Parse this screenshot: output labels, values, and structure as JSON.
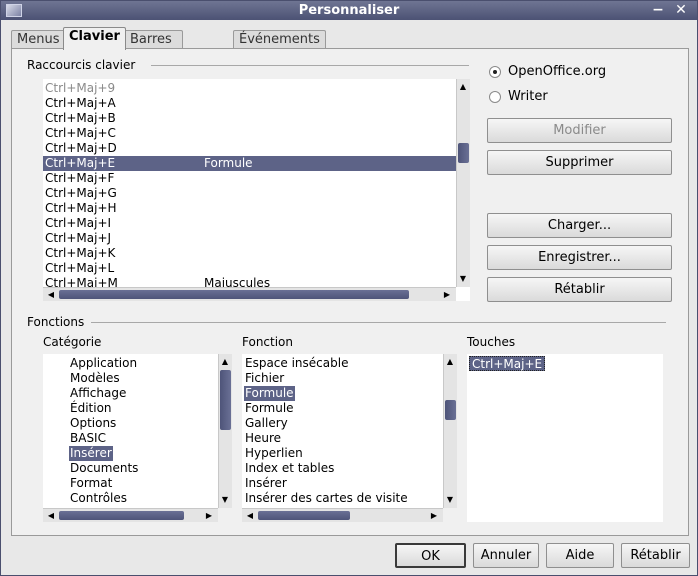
{
  "window": {
    "title": "Personnaliser",
    "minimize_glyph": "−",
    "close_glyph": "✕"
  },
  "tabs": [
    {
      "label": "Menus",
      "active": false
    },
    {
      "label": "Clavier",
      "active": true
    },
    {
      "label": "Barres d'outils",
      "active": false
    },
    {
      "label": "Événements",
      "active": false
    }
  ],
  "shortcuts": {
    "group_label": "Raccourcis clavier",
    "rows": [
      {
        "key": "Ctrl+Maj+9",
        "function": "",
        "selected": false,
        "dimmed": true
      },
      {
        "key": "Ctrl+Maj+A",
        "function": "",
        "selected": false,
        "dimmed": false
      },
      {
        "key": "Ctrl+Maj+B",
        "function": "",
        "selected": false,
        "dimmed": false
      },
      {
        "key": "Ctrl+Maj+C",
        "function": "",
        "selected": false,
        "dimmed": false
      },
      {
        "key": "Ctrl+Maj+D",
        "function": "",
        "selected": false,
        "dimmed": false
      },
      {
        "key": "Ctrl+Maj+E",
        "function": "Formule",
        "selected": true,
        "dimmed": false
      },
      {
        "key": "Ctrl+Maj+F",
        "function": "",
        "selected": false,
        "dimmed": false
      },
      {
        "key": "Ctrl+Maj+G",
        "function": "",
        "selected": false,
        "dimmed": false
      },
      {
        "key": "Ctrl+Maj+H",
        "function": "",
        "selected": false,
        "dimmed": false
      },
      {
        "key": "Ctrl+Maj+I",
        "function": "",
        "selected": false,
        "dimmed": false
      },
      {
        "key": "Ctrl+Maj+J",
        "function": "",
        "selected": false,
        "dimmed": false
      },
      {
        "key": "Ctrl+Maj+K",
        "function": "",
        "selected": false,
        "dimmed": false
      },
      {
        "key": "Ctrl+Maj+L",
        "function": "",
        "selected": false,
        "dimmed": false
      },
      {
        "key": "Ctrl+Maj+M",
        "function": "Majuscules",
        "selected": false,
        "dimmed": false
      }
    ]
  },
  "scope": {
    "options": [
      {
        "label": "OpenOffice.org",
        "checked": true
      },
      {
        "label": "Writer",
        "checked": false
      }
    ]
  },
  "buttons": {
    "modifier": "Modifier",
    "supprimer": "Supprimer",
    "charger": "Charger...",
    "enregistrer": "Enregistrer...",
    "retablir": "Rétablir"
  },
  "functions": {
    "group_label": "Fonctions",
    "category_label": "Catégorie",
    "function_label": "Fonction",
    "keys_label": "Touches",
    "categories": [
      {
        "label": "Application",
        "selected": false
      },
      {
        "label": "Modèles",
        "selected": false
      },
      {
        "label": "Affichage",
        "selected": false
      },
      {
        "label": "Édition",
        "selected": false
      },
      {
        "label": "Options",
        "selected": false
      },
      {
        "label": "BASIC",
        "selected": false
      },
      {
        "label": "Insérer",
        "selected": true
      },
      {
        "label": "Documents",
        "selected": false
      },
      {
        "label": "Format",
        "selected": false
      },
      {
        "label": "Contrôles",
        "selected": false
      }
    ],
    "function_items": [
      {
        "label": "Espace insécable",
        "selected": false
      },
      {
        "label": "Fichier",
        "selected": false
      },
      {
        "label": "Formule",
        "selected": true
      },
      {
        "label": "Formule",
        "selected": false
      },
      {
        "label": "Gallery",
        "selected": false
      },
      {
        "label": "Heure",
        "selected": false
      },
      {
        "label": "Hyperlien",
        "selected": false
      },
      {
        "label": "Index et tables",
        "selected": false
      },
      {
        "label": "Insérer",
        "selected": false
      },
      {
        "label": "Insérer des cartes de visite",
        "selected": false
      }
    ],
    "keys": [
      "Ctrl+Maj+E"
    ]
  },
  "footer": {
    "ok": "OK",
    "annuler": "Annuler",
    "aide": "Aide",
    "retablir": "Rétablir"
  },
  "colors": {
    "selection": "#5d6387",
    "titlebar": "#575d7e"
  },
  "glyphs": {
    "up": "▲",
    "down": "▼",
    "left": "◀",
    "right": "▶"
  }
}
